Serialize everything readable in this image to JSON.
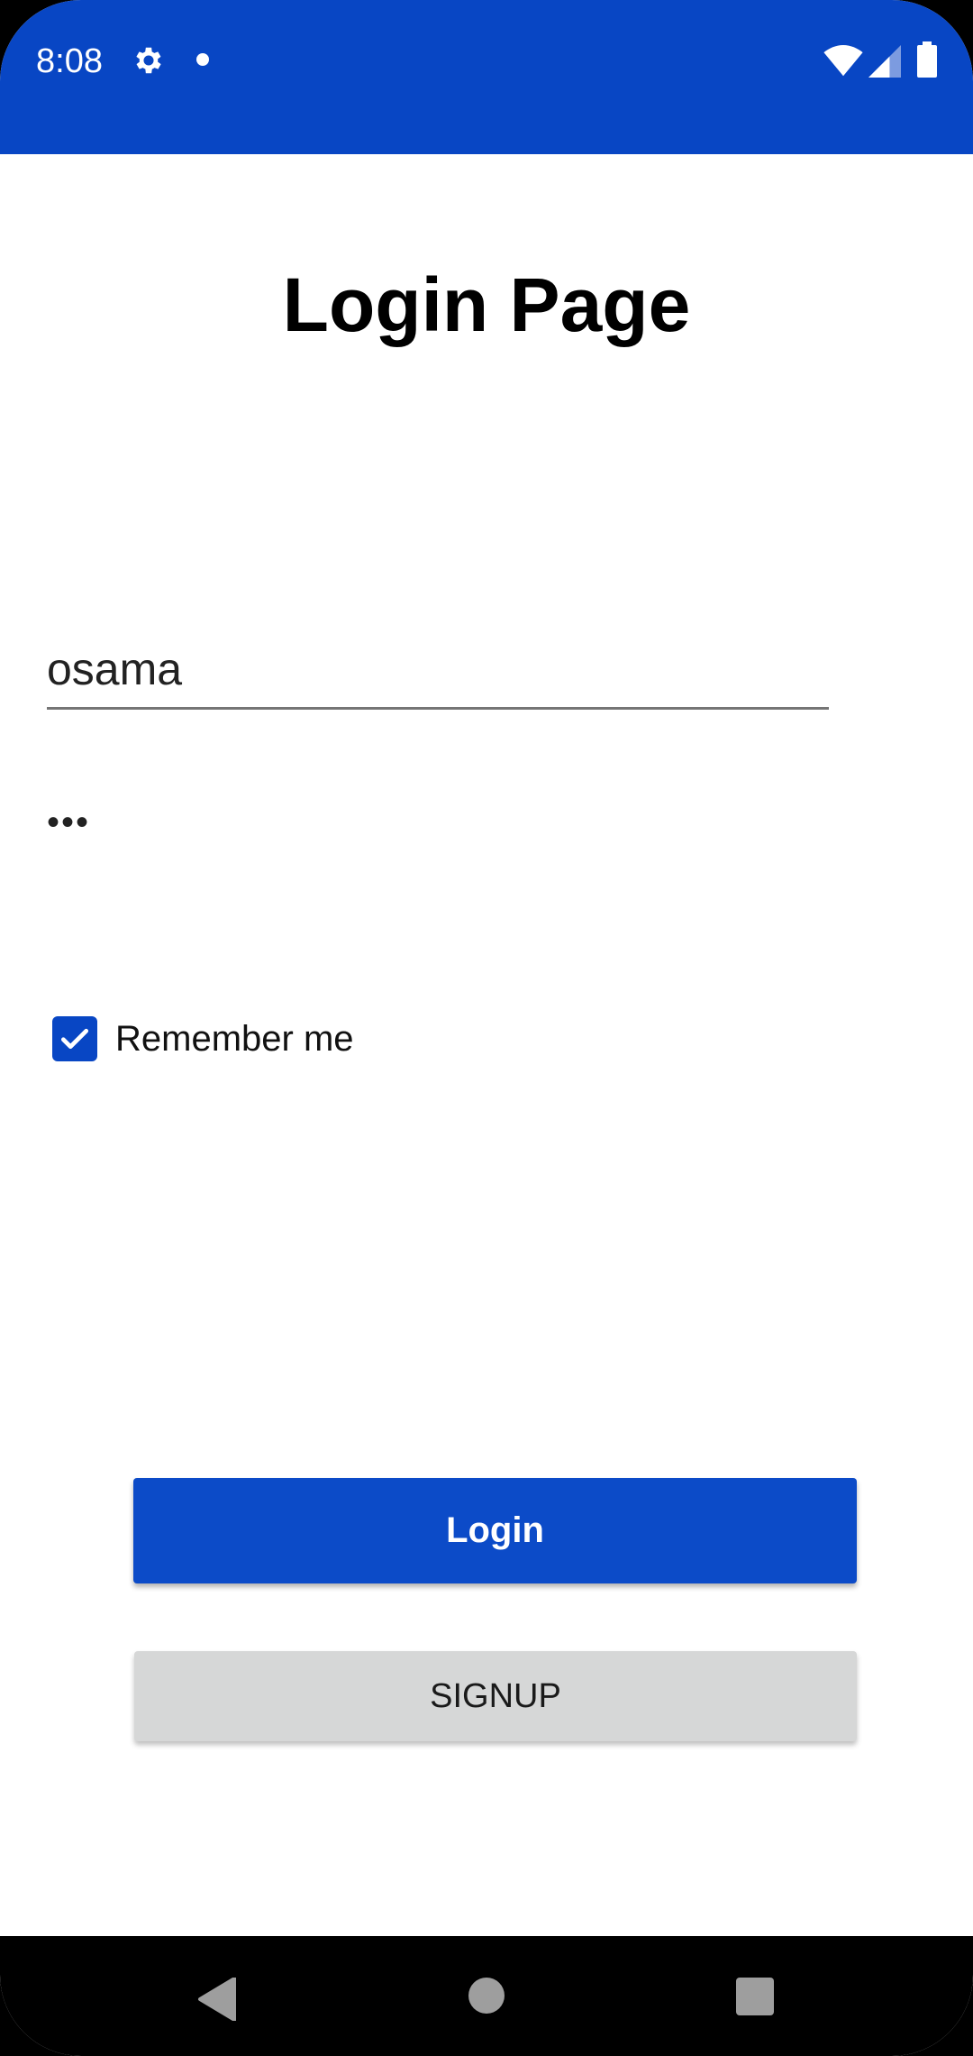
{
  "status_bar": {
    "time": "8:08",
    "icons": [
      "gear-icon",
      "notification-dot-icon",
      "wifi-icon",
      "signal-icon",
      "battery-icon"
    ]
  },
  "page": {
    "title": "Login Page"
  },
  "form": {
    "username_value": "osama",
    "password_value": "•••",
    "remember_label": "Remember me",
    "remember_checked": true
  },
  "buttons": {
    "login_label": "Login",
    "signup_label": "SIGNUP"
  },
  "navigation": {
    "icons": [
      "back-icon",
      "home-icon",
      "recents-icon"
    ]
  },
  "colors": {
    "primary": "#0846c4",
    "secondary_button": "#d6d7d7",
    "nav_bar": "#000000"
  }
}
